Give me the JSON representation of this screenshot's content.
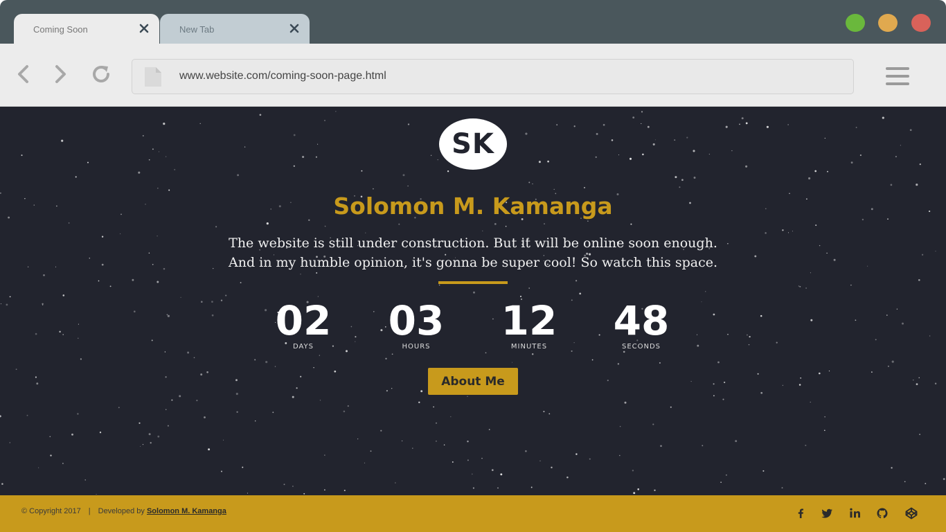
{
  "tabs": [
    {
      "label": "Coming Soon",
      "active": true
    },
    {
      "label": "New Tab",
      "active": false
    }
  ],
  "window_controls": [
    {
      "name": "maximize",
      "color": "#6ab83c"
    },
    {
      "name": "minimize",
      "color": "#e0a94f"
    },
    {
      "name": "close",
      "color": "#d9625a"
    }
  ],
  "address_bar": {
    "url": "www.website.com/coming-soon-page.html"
  },
  "toolbar_icons": [
    "back-arrow-icon",
    "forward-arrow-icon",
    "reload-icon",
    "page-icon",
    "hamburger-menu-icon"
  ],
  "page": {
    "logo_text": "SK",
    "name": "Solomon M. Kamanga",
    "description_line1": "The website is still under construction. But it will be online soon enough.",
    "description_line2": "And in my humble opinion, it's gonna be super cool! So watch this space.",
    "countdown": [
      {
        "value": "02",
        "label": "DAYS"
      },
      {
        "value": "03",
        "label": "HOURS"
      },
      {
        "value": "12",
        "label": "MINUTES"
      },
      {
        "value": "48",
        "label": "SECONDS"
      }
    ],
    "button_label": "About Me"
  },
  "footer": {
    "copyright": "© Copyright 2017",
    "separator": "|",
    "developed_by": "Developed by",
    "developer": "Solomon M. Kamanga",
    "social_icons": [
      "facebook-icon",
      "twitter-icon",
      "linkedin-icon",
      "github-icon",
      "codepen-icon"
    ]
  },
  "colors": {
    "accent": "#c89a1c",
    "page_background": "#22242e",
    "tab_strip": "#4a575c",
    "toolbar": "#ececec"
  }
}
